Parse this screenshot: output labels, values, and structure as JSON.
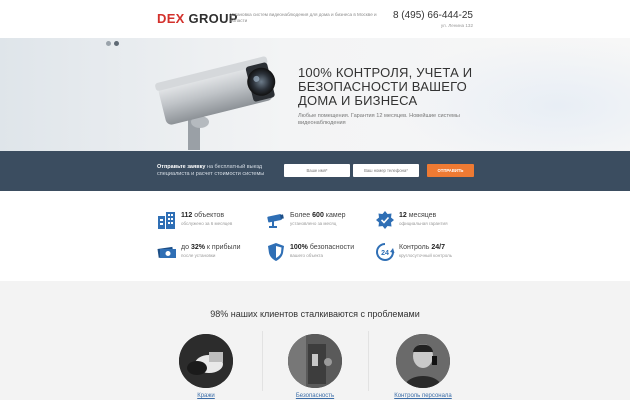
{
  "header": {
    "logo_part1": "DEX",
    "logo_part2": " GROUP",
    "tagline": "Установка систем видеонаблюдения для дома и бизнеса в Москве и области",
    "phone": "8 (495) 66-444-25",
    "address": "ул. Ленина 132"
  },
  "hero": {
    "title": "100% КОНТРОЛЯ, УЧЕТА И БЕЗОПАСНОСТИ ВАШЕГО ДОМА И БИЗНЕСА",
    "subtitle": "Любые помещения. Гарантия 12 месяцев. Новейшие системы видеонаблюдения",
    "slide_count": 2,
    "active_slide": 2
  },
  "request": {
    "text_bold": "Отправьте заявку",
    "text_rest": " на бесплатный выезд специалиста и расчет стоимости системы",
    "name_placeholder": "Ваше имя*",
    "phone_placeholder": "Ваш номер телефона*",
    "submit_label": "ОТПРАВИТЬ"
  },
  "stats": [
    {
      "icon": "buildings-icon",
      "bold": "112",
      "rest": " объектов",
      "sub": "обслужено за 6 месяцев"
    },
    {
      "icon": "camera-icon",
      "pre": "Более ",
      "bold": "600",
      "rest": " камер",
      "sub": "установлено за месяц"
    },
    {
      "icon": "badge-icon",
      "bold": "12",
      "rest": " месяцев",
      "sub": "официальная гарантия"
    },
    {
      "icon": "money-icon",
      "pre": "до ",
      "bold": "32%",
      "rest": " к прибыли",
      "sub": "после установки"
    },
    {
      "icon": "shield-icon",
      "bold": "100%",
      "rest": " безопасности",
      "sub": "вашего объекта"
    },
    {
      "icon": "clock-24-icon",
      "pre": "Контроль ",
      "bold": "24/7",
      "rest": "",
      "sub": "круглосуточный контроль"
    }
  ],
  "problems": {
    "title": "98% наших клиентов сталкиваются с проблемами",
    "items": [
      {
        "label": "Кражи"
      },
      {
        "label": "Безопасность"
      },
      {
        "label": "Контроль персонала"
      }
    ]
  },
  "colors": {
    "brand_red": "#d3312c",
    "band_bg": "#3b4d60",
    "button_orange": "#ee7a33",
    "icon_blue": "#2f6fb5"
  }
}
